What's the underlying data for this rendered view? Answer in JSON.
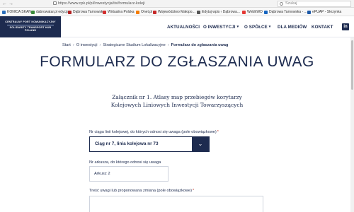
{
  "browser": {
    "back": "←",
    "forward": "→",
    "url": "https://www.cpk.pl/pl/inwestycja/tis/formularz-koleji",
    "search_placeholder": "Szukaj",
    "bookmarks": [
      {
        "label": "KONICA SKAN",
        "color": "#2a6ebb"
      },
      {
        "label": "dabrowatar.pl edycja",
        "color": "#3a8a3a"
      },
      {
        "label": "Dąbrowa Tarnowska",
        "color": "#b22222"
      },
      {
        "label": "Wirtualna Polska",
        "color": "#d32f2f"
      },
      {
        "label": "Onet.pl",
        "color": "#f57c00"
      },
      {
        "label": "Województwo Małopo...",
        "color": "#c62828"
      },
      {
        "label": "Edytuj wpis ‹ Dąbrowa...",
        "color": "#555555"
      },
      {
        "label": "WebEWD",
        "color": "#e53935"
      },
      {
        "label": "Dąbrowa Tarnowska - ...",
        "color": "#1565c0"
      },
      {
        "label": "ePUAP - Skrzynka",
        "color": "#1e5aa8"
      }
    ]
  },
  "header": {
    "logo_line1": "CENTRALNY PORT KOMUNIKACYJNY",
    "logo_line2": "SOLIDARITY TRANSPORT HUB",
    "logo_line3": "POLAND",
    "nav": [
      {
        "label": "AKTUALNOŚCI",
        "dropdown": false
      },
      {
        "label": "O INWESTYCJI",
        "dropdown": true
      },
      {
        "label": "O SPÓŁCE",
        "dropdown": true
      },
      {
        "label": "DLA MEDIÓW",
        "dropdown": false
      },
      {
        "label": "KONTAKT",
        "dropdown": false
      }
    ],
    "linkedin": "in"
  },
  "breadcrumb": {
    "items": [
      "Start",
      "O inwestycji",
      "Strategiczne Studium Lokalizacyjne",
      "Formularz do zgłaszania uwag"
    ],
    "separator": "›"
  },
  "page": {
    "title": "FORMULARZ DO ZGŁASZANIA UWAG",
    "subtitle_line1": "Załącznik nr 1. Atlasy map przebiegów korytarzy",
    "subtitle_line2": "Kolejowych Liniowych Inwestycji Towarzyszących"
  },
  "form": {
    "line_label": "Nr ciągu linii kolejowej, do których odnosi się uwaga (pole obowiązkowe)",
    "line_value": "Ciąg nr 7, linia kolejowa nr 73",
    "sheet_label": "Nr arkusza, do którego odnosi się uwaga",
    "sheet_value": "Arkusz 2",
    "comment_label": "Treść uwagi lub proponowana zmiana (pole obowiązkowe)",
    "required_mark": "*",
    "dropdown_glyph": "⌄"
  }
}
